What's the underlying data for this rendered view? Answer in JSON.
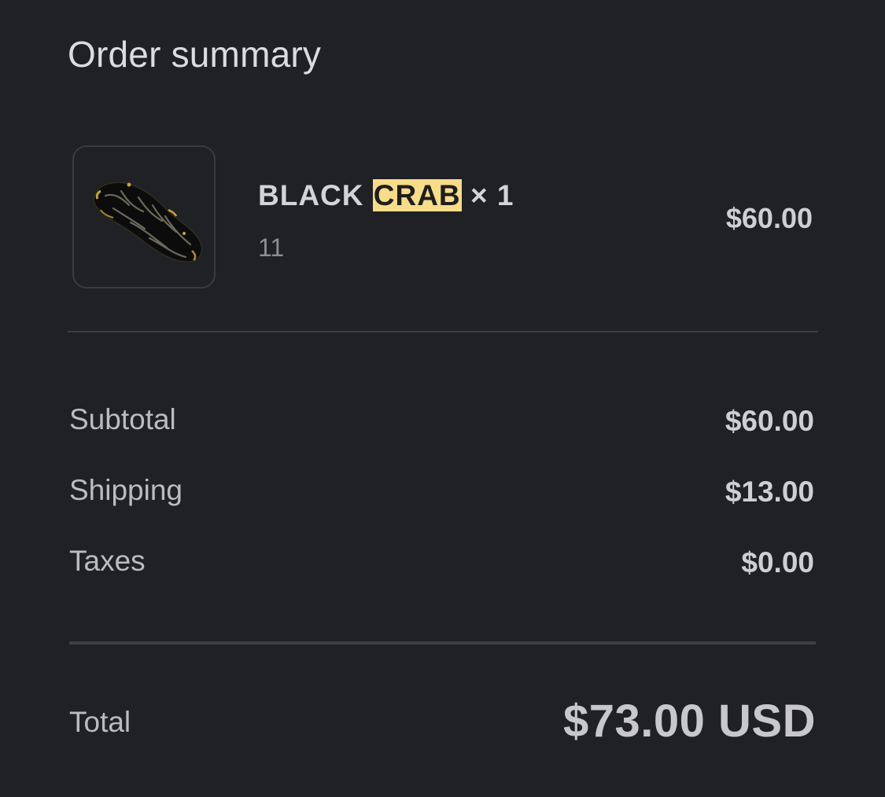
{
  "header": {
    "title": "Order summary"
  },
  "line_item": {
    "name_prefix": "BLACK",
    "name_highlight": "CRAB",
    "quantity_text": "× 1",
    "variant": "11",
    "price": "$60.00",
    "thumbnail_icon": "black-crab-shoe-thumbnail"
  },
  "summary": {
    "rows": [
      {
        "label": "Subtotal",
        "value": "$60.00"
      },
      {
        "label": "Shipping",
        "value": "$13.00"
      },
      {
        "label": "Taxes",
        "value": "$0.00"
      }
    ],
    "total_label": "Total",
    "total_value": "$73.00 USD"
  },
  "colors": {
    "background": "#202125",
    "highlight": "#f7dc8a",
    "divider": "#3c3d42"
  }
}
